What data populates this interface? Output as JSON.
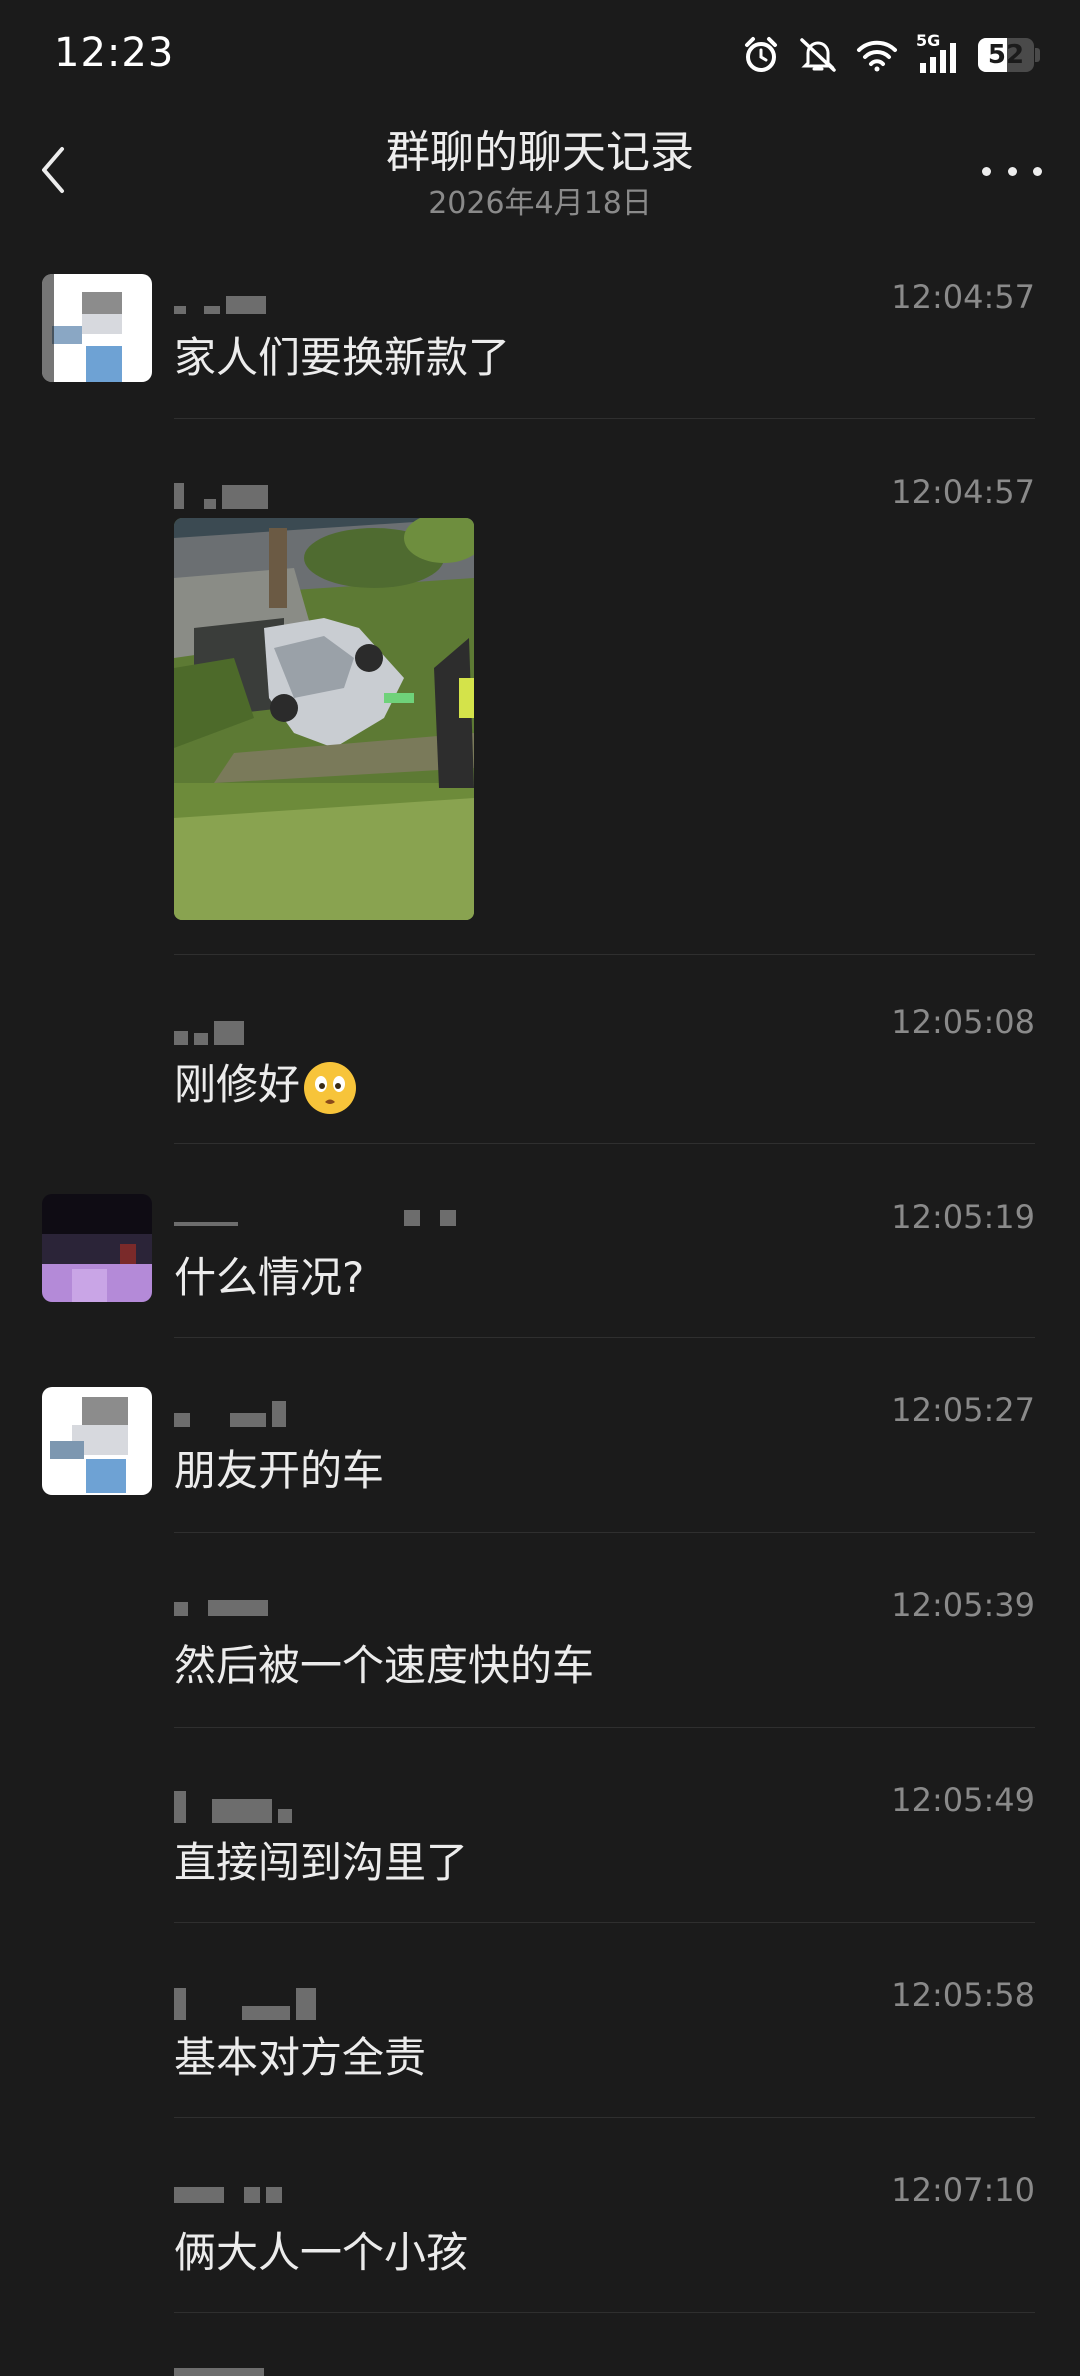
{
  "status_bar": {
    "time": "12:23",
    "network": "5G",
    "battery": "52",
    "icons": [
      "alarm-icon",
      "mute-icon",
      "wifi-icon",
      "signal-icon",
      "battery-icon"
    ]
  },
  "header": {
    "title": "群聊的聊天记录",
    "date": "2026年4月18日",
    "icons": [
      "back-arrow-icon",
      "more-icon"
    ]
  },
  "messages": [
    {
      "time": "12:04:57",
      "text": "家人们要换新款了"
    },
    {
      "time": "12:04:57",
      "text": ""
    },
    {
      "time": "12:05:08",
      "text": "刚修好"
    },
    {
      "time": "12:05:19",
      "text": "什么情况?"
    },
    {
      "time": "12:05:27",
      "text": "朋友开的车"
    },
    {
      "time": "12:05:39",
      "text": "然后被一个速度快的车"
    },
    {
      "time": "12:05:49",
      "text": "直接闯到沟里了"
    },
    {
      "time": "12:05:58",
      "text": "基本对方全责"
    },
    {
      "time": "12:07:10",
      "text": "俩大人一个小孩"
    }
  ],
  "colors": {
    "background": "#1b1b1b",
    "text": "#ececec",
    "secondary_text": "#8a8a8a",
    "divider": "#2f2f2f"
  }
}
